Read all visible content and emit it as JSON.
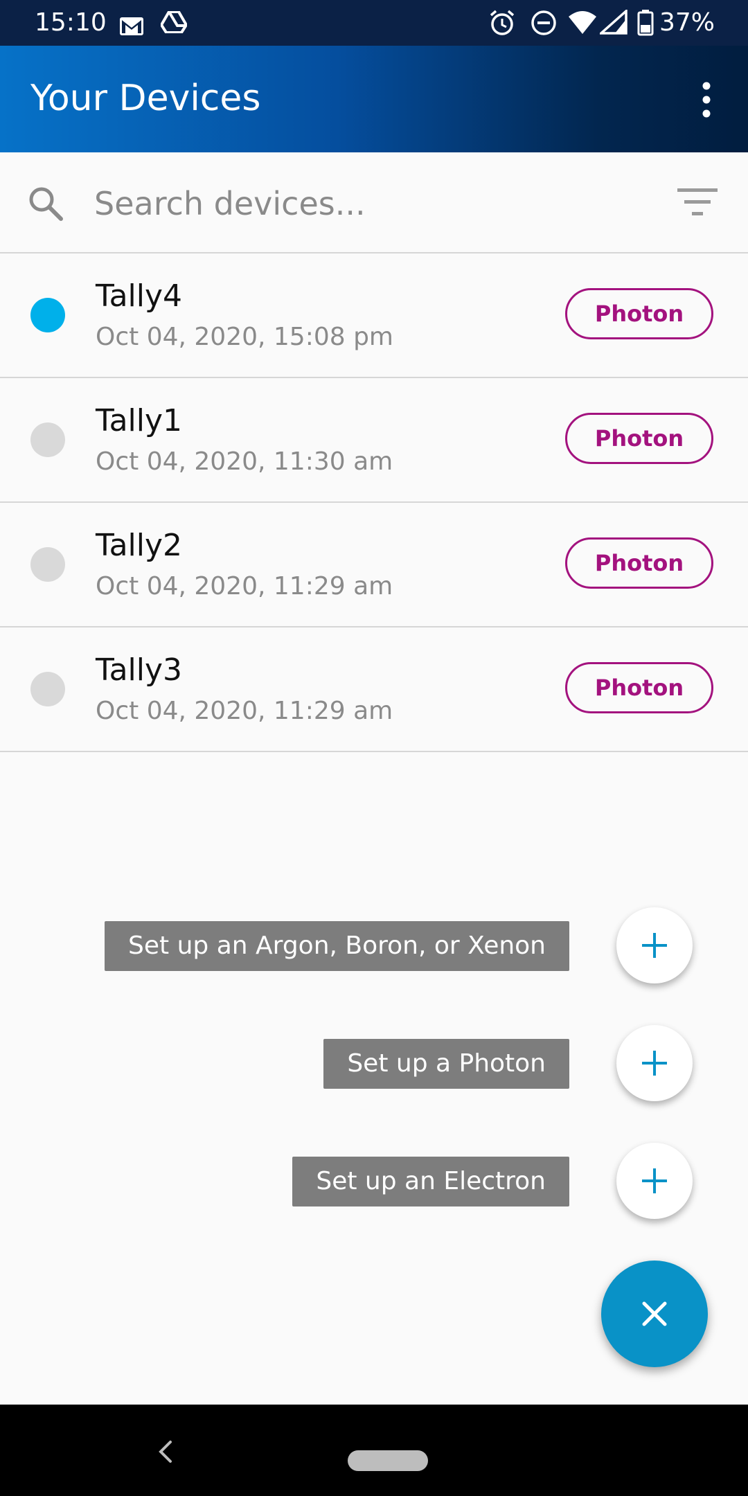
{
  "status_bar": {
    "time": "15:10",
    "battery_percent": "37%",
    "icons": [
      "gmail-icon",
      "drive-icon",
      "alarm-icon",
      "dnd-icon",
      "wifi-icon",
      "signal-icon",
      "battery-icon"
    ]
  },
  "app_bar": {
    "title": "Your Devices",
    "overflow_icon": "more-vert-icon"
  },
  "search": {
    "placeholder": "Search devices...",
    "value": "",
    "icon": "search-icon",
    "filter_icon": "filter-icon"
  },
  "devices": [
    {
      "name": "Tally4",
      "last_seen": "Oct 04, 2020, 15:08 pm",
      "type": "Photon",
      "online": true,
      "status_color": "#00b0ea"
    },
    {
      "name": "Tally1",
      "last_seen": "Oct 04, 2020, 11:30 am",
      "type": "Photon",
      "online": false,
      "status_color": "#d9d9d9"
    },
    {
      "name": "Tally2",
      "last_seen": "Oct 04, 2020, 11:29 am",
      "type": "Photon",
      "online": false,
      "status_color": "#d9d9d9"
    },
    {
      "name": "Tally3",
      "last_seen": "Oct 04, 2020, 11:29 am",
      "type": "Photon",
      "online": false,
      "status_color": "#d9d9d9"
    }
  ],
  "fab_menu": {
    "items": [
      {
        "label": "Set up an Argon, Boron, or Xenon",
        "icon": "plus-icon"
      },
      {
        "label": "Set up a Photon",
        "icon": "plus-icon"
      },
      {
        "label": "Set up an Electron",
        "icon": "plus-icon"
      }
    ],
    "close_icon": "close-icon"
  },
  "colors": {
    "accent": "#0992c7",
    "device_type": "#a3127e",
    "online": "#00b0ea",
    "offline": "#d9d9d9"
  },
  "nav_bar": {
    "back_icon": "back-icon",
    "home_icon": "home-pill-icon"
  }
}
